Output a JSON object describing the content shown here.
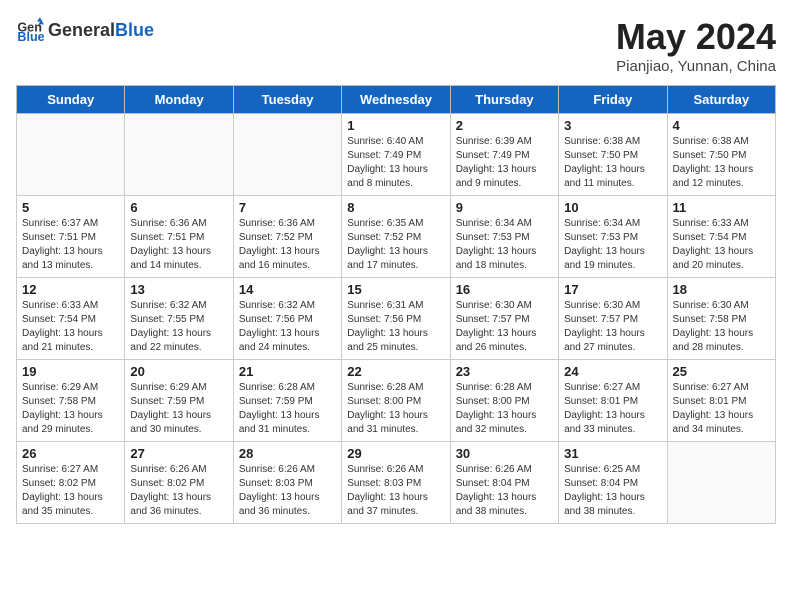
{
  "header": {
    "logo_general": "General",
    "logo_blue": "Blue",
    "title": "May 2024",
    "location": "Pianjiao, Yunnan, China"
  },
  "days_of_week": [
    "Sunday",
    "Monday",
    "Tuesday",
    "Wednesday",
    "Thursday",
    "Friday",
    "Saturday"
  ],
  "weeks": [
    [
      {
        "day": "",
        "info": ""
      },
      {
        "day": "",
        "info": ""
      },
      {
        "day": "",
        "info": ""
      },
      {
        "day": "1",
        "info": "Sunrise: 6:40 AM\nSunset: 7:49 PM\nDaylight: 13 hours\nand 8 minutes."
      },
      {
        "day": "2",
        "info": "Sunrise: 6:39 AM\nSunset: 7:49 PM\nDaylight: 13 hours\nand 9 minutes."
      },
      {
        "day": "3",
        "info": "Sunrise: 6:38 AM\nSunset: 7:50 PM\nDaylight: 13 hours\nand 11 minutes."
      },
      {
        "day": "4",
        "info": "Sunrise: 6:38 AM\nSunset: 7:50 PM\nDaylight: 13 hours\nand 12 minutes."
      }
    ],
    [
      {
        "day": "5",
        "info": "Sunrise: 6:37 AM\nSunset: 7:51 PM\nDaylight: 13 hours\nand 13 minutes."
      },
      {
        "day": "6",
        "info": "Sunrise: 6:36 AM\nSunset: 7:51 PM\nDaylight: 13 hours\nand 14 minutes."
      },
      {
        "day": "7",
        "info": "Sunrise: 6:36 AM\nSunset: 7:52 PM\nDaylight: 13 hours\nand 16 minutes."
      },
      {
        "day": "8",
        "info": "Sunrise: 6:35 AM\nSunset: 7:52 PM\nDaylight: 13 hours\nand 17 minutes."
      },
      {
        "day": "9",
        "info": "Sunrise: 6:34 AM\nSunset: 7:53 PM\nDaylight: 13 hours\nand 18 minutes."
      },
      {
        "day": "10",
        "info": "Sunrise: 6:34 AM\nSunset: 7:53 PM\nDaylight: 13 hours\nand 19 minutes."
      },
      {
        "day": "11",
        "info": "Sunrise: 6:33 AM\nSunset: 7:54 PM\nDaylight: 13 hours\nand 20 minutes."
      }
    ],
    [
      {
        "day": "12",
        "info": "Sunrise: 6:33 AM\nSunset: 7:54 PM\nDaylight: 13 hours\nand 21 minutes."
      },
      {
        "day": "13",
        "info": "Sunrise: 6:32 AM\nSunset: 7:55 PM\nDaylight: 13 hours\nand 22 minutes."
      },
      {
        "day": "14",
        "info": "Sunrise: 6:32 AM\nSunset: 7:56 PM\nDaylight: 13 hours\nand 24 minutes."
      },
      {
        "day": "15",
        "info": "Sunrise: 6:31 AM\nSunset: 7:56 PM\nDaylight: 13 hours\nand 25 minutes."
      },
      {
        "day": "16",
        "info": "Sunrise: 6:30 AM\nSunset: 7:57 PM\nDaylight: 13 hours\nand 26 minutes."
      },
      {
        "day": "17",
        "info": "Sunrise: 6:30 AM\nSunset: 7:57 PM\nDaylight: 13 hours\nand 27 minutes."
      },
      {
        "day": "18",
        "info": "Sunrise: 6:30 AM\nSunset: 7:58 PM\nDaylight: 13 hours\nand 28 minutes."
      }
    ],
    [
      {
        "day": "19",
        "info": "Sunrise: 6:29 AM\nSunset: 7:58 PM\nDaylight: 13 hours\nand 29 minutes."
      },
      {
        "day": "20",
        "info": "Sunrise: 6:29 AM\nSunset: 7:59 PM\nDaylight: 13 hours\nand 30 minutes."
      },
      {
        "day": "21",
        "info": "Sunrise: 6:28 AM\nSunset: 7:59 PM\nDaylight: 13 hours\nand 31 minutes."
      },
      {
        "day": "22",
        "info": "Sunrise: 6:28 AM\nSunset: 8:00 PM\nDaylight: 13 hours\nand 31 minutes."
      },
      {
        "day": "23",
        "info": "Sunrise: 6:28 AM\nSunset: 8:00 PM\nDaylight: 13 hours\nand 32 minutes."
      },
      {
        "day": "24",
        "info": "Sunrise: 6:27 AM\nSunset: 8:01 PM\nDaylight: 13 hours\nand 33 minutes."
      },
      {
        "day": "25",
        "info": "Sunrise: 6:27 AM\nSunset: 8:01 PM\nDaylight: 13 hours\nand 34 minutes."
      }
    ],
    [
      {
        "day": "26",
        "info": "Sunrise: 6:27 AM\nSunset: 8:02 PM\nDaylight: 13 hours\nand 35 minutes."
      },
      {
        "day": "27",
        "info": "Sunrise: 6:26 AM\nSunset: 8:02 PM\nDaylight: 13 hours\nand 36 minutes."
      },
      {
        "day": "28",
        "info": "Sunrise: 6:26 AM\nSunset: 8:03 PM\nDaylight: 13 hours\nand 36 minutes."
      },
      {
        "day": "29",
        "info": "Sunrise: 6:26 AM\nSunset: 8:03 PM\nDaylight: 13 hours\nand 37 minutes."
      },
      {
        "day": "30",
        "info": "Sunrise: 6:26 AM\nSunset: 8:04 PM\nDaylight: 13 hours\nand 38 minutes."
      },
      {
        "day": "31",
        "info": "Sunrise: 6:25 AM\nSunset: 8:04 PM\nDaylight: 13 hours\nand 38 minutes."
      },
      {
        "day": "",
        "info": ""
      }
    ]
  ]
}
